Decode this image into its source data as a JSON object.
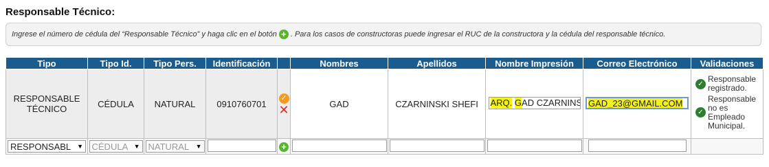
{
  "section": {
    "title": "Responsable Técnico:",
    "info_before": "Ingrese el número de cédula del “Responsable Técnico” y haga clic en el botón",
    "info_after": ". Para los casos de constructoras puede ingresar el RUC de la constructora y la cédula del responsable técnico."
  },
  "table": {
    "headers": {
      "tipo": "Tipo",
      "tipo_id": "Tipo Id.",
      "tipo_pers": "Tipo Pers.",
      "identificacion": "Identificación",
      "nombres": "Nombres",
      "apellidos": "Apellidos",
      "nombre_impresion": "Nombre Impresión",
      "correo": "Correo Electrónico",
      "validaciones": "Validaciones"
    },
    "row": {
      "tipo": "RESPONSABLE TÉCNICO",
      "tipo_id": "CÉDULA",
      "tipo_pers": "NATURAL",
      "identificacion": "0910760701",
      "nombres": "GAD",
      "apellidos": "CZARNINSKI SHEFI",
      "nombre_impresion_prefix": "ARQ.",
      "nombre_impresion_hl": "G",
      "nombre_impresion_rest": "AD CZARNINS",
      "correo": "GAD_23@GMAIL.COM",
      "validaciones": [
        "Responsable registrado.",
        "Responsable no es Empleado Municipal."
      ]
    },
    "entry": {
      "tipo_select": "RESPONSABL",
      "tipo_id_select": "CÉDULA",
      "tipo_pers_select": "NATURAL"
    }
  },
  "colors": {
    "header_bg": "#1a5c8d",
    "highlight": "#f5f21a",
    "add_green": "#58b52d",
    "edit_orange": "#f39b1e",
    "delete_red": "#e0262b",
    "valid_green": "#2e7d32"
  },
  "icons": [
    "add-icon",
    "edit-check-icon",
    "delete-x-icon",
    "check-circle-icon",
    "dropdown-arrow-icon"
  ]
}
